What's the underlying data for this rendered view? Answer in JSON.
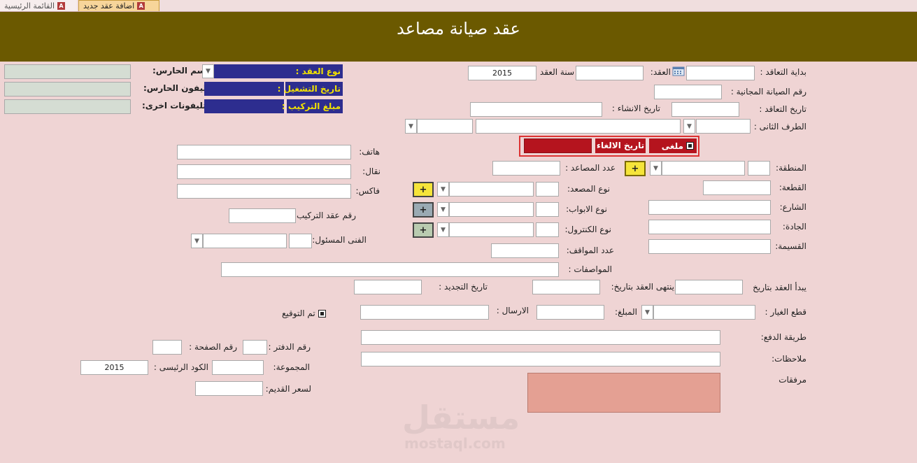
{
  "tabs": {
    "home": "القائمة الرئيسية",
    "add_contract": "اضافة عقد جديد"
  },
  "header": {
    "title": "عقد صيانة مصاعد"
  },
  "colors": {
    "header_bg": "#6b5900",
    "page_bg": "#efd4d4",
    "navy": "#2d2d8f",
    "yellow_text": "#f2e200",
    "cancel_red": "#b5141e",
    "attach_box": "#e4a093",
    "plus_yellow": "#f5e43a",
    "plus_gray": "#9aaab3",
    "plus_green": "#b9cbb0"
  },
  "icons": {
    "app_icon": "access-icon",
    "calendar": "calendar-icon",
    "dropdown": "chevron-down-icon"
  },
  "right": {
    "contract_start": "بداية التعاقد :",
    "contract": "العقد:",
    "contract_year": "سنة العقد",
    "contract_year_value": "2015",
    "free_maint_no": "رقم الصيانة المجانية :",
    "contract_date": "تاريخ التعاقد :",
    "creation_date": "تاريخ الانشاء :",
    "second_party": "الطرف الثانى :",
    "cancelled": "ملغى",
    "cancel_date": "تاريخ الالغاء",
    "region": "المنطقة:",
    "elevator_count": "عدد المصاعد :",
    "plot": "القطعة:",
    "elevator_type": "نوع المصعد:",
    "street": "الشارع:",
    "door_type": "نوع الابواب:",
    "avenue": "الجادة:",
    "control_type": "نوع الكنترول:",
    "parcel": "القسيمة:",
    "stops_count": "عدد المواقف:",
    "specs": "المواصفات :",
    "starts_date": "يبدأ العقد بتاريخ",
    "ends_date": "ينتهى العقد بتاريخ:",
    "renewal_date": "تاريخ التجديد :",
    "spare_parts": "قطع الغيار :",
    "amount": "المبلغ:",
    "sending": "الارسال :",
    "signed": "تم التوقيع",
    "payment_method": "طريقة الدفع:",
    "notes": "ملاحظات:",
    "attachments": "مرفقات"
  },
  "left": {
    "contract_type": "نوع العقد :",
    "operation_date": "تاريخ التشغيل :",
    "install_amount": "مبلغ التركيب :",
    "guard_name": "سم الحارس:",
    "guard_phone": "تليفون الحارس:",
    "other_phones": "تليفونات اخرى:",
    "phone": "هاتف:",
    "mobile": "نقال:",
    "fax": "فاكس:",
    "install_contract_no": "رقم عقد التركيب:",
    "tech_responsible": "الفنى المسئول:",
    "book_no": "رقم الدفتر :",
    "page_no": "رقم الصفحة :",
    "group": "المجموعة:",
    "main_code": "الكود الرئيسى :",
    "main_code_value": "2015",
    "old_price": "لسعر القديم:"
  },
  "buttons": {
    "plus": "+"
  },
  "watermark": {
    "logo": "مستقل",
    "site": "mostaql.com"
  }
}
